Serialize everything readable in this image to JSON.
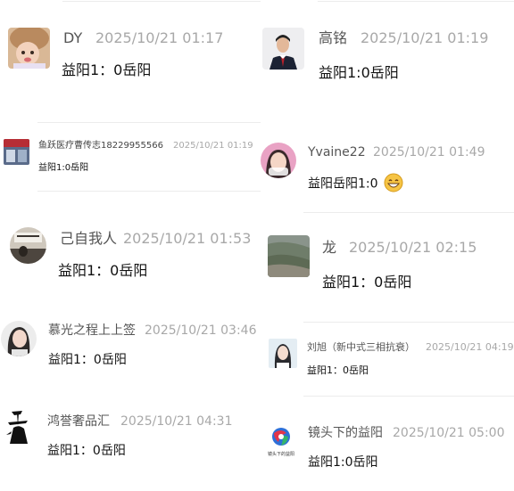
{
  "comments": [
    {
      "name": "DY",
      "time": "2025/10/21 01:17",
      "text": "益阳1：0岳阳",
      "avatar": "baby-avatar"
    },
    {
      "name": "高铭",
      "time": "2025/10/21 01:19",
      "text": "益阳1:0岳阳",
      "avatar": "man-in-suit-avatar"
    },
    {
      "name": "鱼跃医疗曹传志18229955566",
      "time": "2025/10/21 01:19",
      "text": "益阳1:0岳阳",
      "avatar": "storefront-avatar"
    },
    {
      "name": "Yvaine22",
      "time": "2025/10/21 01:49",
      "text": "益阳岳阳1:0",
      "avatar": "girl-avatar",
      "emoji": "grinning-face-emoji"
    },
    {
      "name": "己自我人",
      "time": "2025/10/21 01:53",
      "text": "益阳1：0岳阳",
      "avatar": "calligraphy-room-avatar"
    },
    {
      "name": "龙",
      "time": "2025/10/21 02:15",
      "text": "益阳1：0岳阳",
      "avatar": "landscape-avatar"
    },
    {
      "name": "慕光之程上上签",
      "time": "2025/10/21 03:46",
      "text": "益阳1：0岳阳",
      "avatar": "woman-portrait-avatar"
    },
    {
      "name": "刘旭（新中式三相抗衰）",
      "time": "2025/10/21 04:19",
      "text": "益阳1：0岳阳",
      "avatar": "woman-photo-avatar"
    },
    {
      "name": "鸿誉奢品汇",
      "time": "2025/10/21 04:31",
      "text": "益阳1：0岳阳",
      "avatar": "ink-calligraphy-avatar"
    },
    {
      "name": "镜头下的益阳",
      "time": "2025/10/21 05:00",
      "text": "益阳1:0岳阳",
      "avatar": "lens-logo-avatar"
    }
  ],
  "lens_logo_caption": "镜头下的益阳"
}
